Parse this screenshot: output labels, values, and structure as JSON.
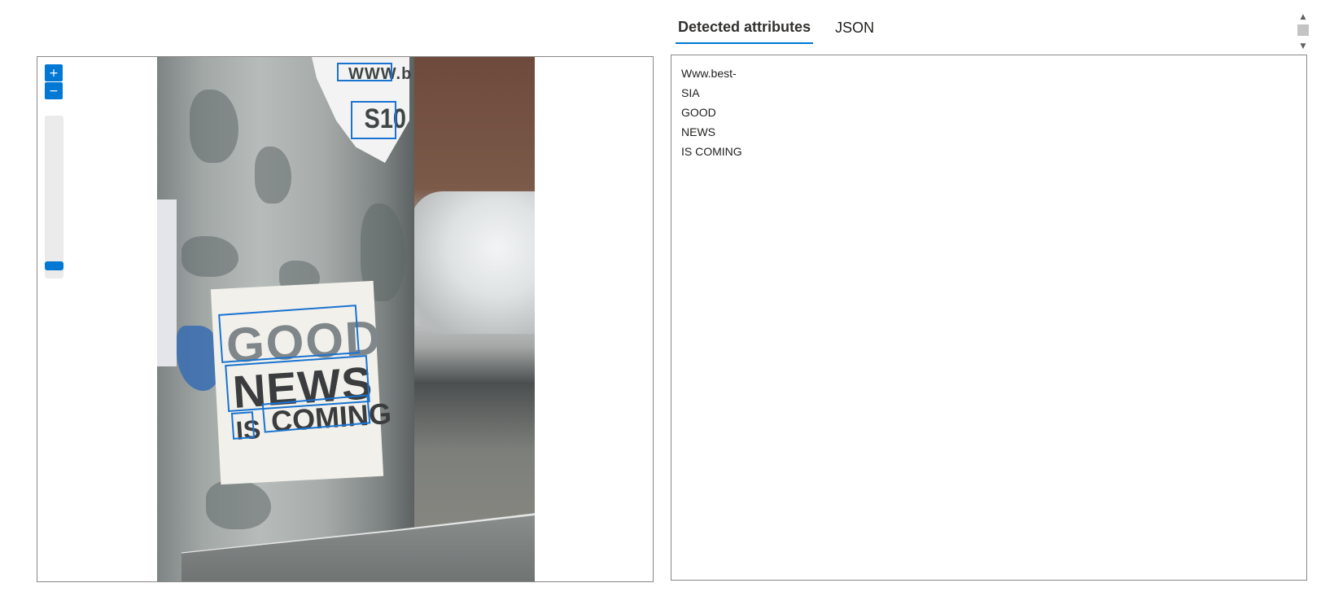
{
  "zoom": {
    "in_label": "+",
    "out_label": "−",
    "level": 0.1
  },
  "image_text": {
    "top_line_1": "WWW.b",
    "top_line_2": "S10",
    "good": "GOOD",
    "news": "NEWS",
    "is": "IS",
    "coming": "COMING"
  },
  "tabs": [
    {
      "label": "Detected attributes",
      "active": true
    },
    {
      "label": "JSON",
      "active": false
    }
  ],
  "results": [
    "Www.best-",
    "SIA",
    "GOOD",
    "NEWS",
    "IS COMING"
  ],
  "scrollbar": {
    "up_icon": "chevron-up-icon",
    "down_icon": "chevron-down-icon"
  },
  "colors": {
    "accent": "#0078d4",
    "box": "#1a73d1"
  }
}
